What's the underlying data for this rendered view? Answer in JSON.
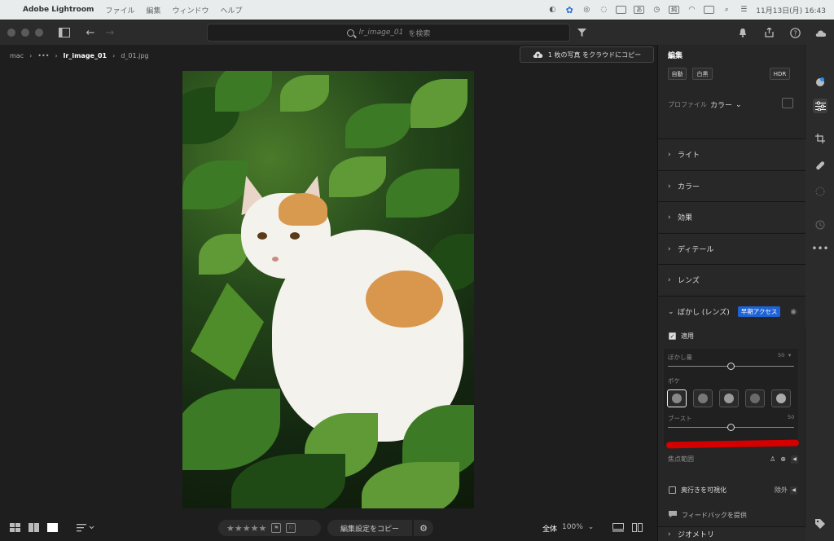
{
  "menubar": {
    "app": "Adobe Lightroom",
    "items": [
      "ファイル",
      "編集",
      "ウィンドウ",
      "ヘルプ"
    ],
    "ime": "あ",
    "battery": "純",
    "datetime": "11月13日(月) 16:43"
  },
  "search": {
    "query": "lr_image_01",
    "suffix": "を検索"
  },
  "breadcrumb": {
    "root": "mac",
    "ellipsis": "•••",
    "album": "lr_image_01",
    "file": "d_01.jpg"
  },
  "cloud_copy": {
    "label": "1 枚の写真 をクラウドにコピー"
  },
  "edit_panel": {
    "title": "編集",
    "auto": "自動",
    "bw": "白黒",
    "hdr": "HDR",
    "profile_label": "プロファイル",
    "profile_value": "カラー",
    "sections": [
      "ライト",
      "カラー",
      "効果",
      "ディテール",
      "レンズ"
    ],
    "blur": {
      "title": "ぼかし (レンズ)",
      "badge": "早期アクセス",
      "apply": "適用",
      "amount_label": "ぼかし量",
      "amount_value": "50",
      "amount_fraction": 0.5,
      "bokeh_label": "ボケ",
      "boost_label": "ブースト",
      "boost_value": "50",
      "boost_fraction": 0.5,
      "focus_range": "焦点範囲",
      "depth_visualize": "奥行きを可視化",
      "exclude": "除外",
      "feedback": "フィードバックを提供"
    },
    "geometry": "ジオメトリ"
  },
  "bottom": {
    "stars": "★★★★★",
    "copy_settings": "編集設定をコピー",
    "zoom_label": "全体",
    "zoom_value": "100%"
  }
}
